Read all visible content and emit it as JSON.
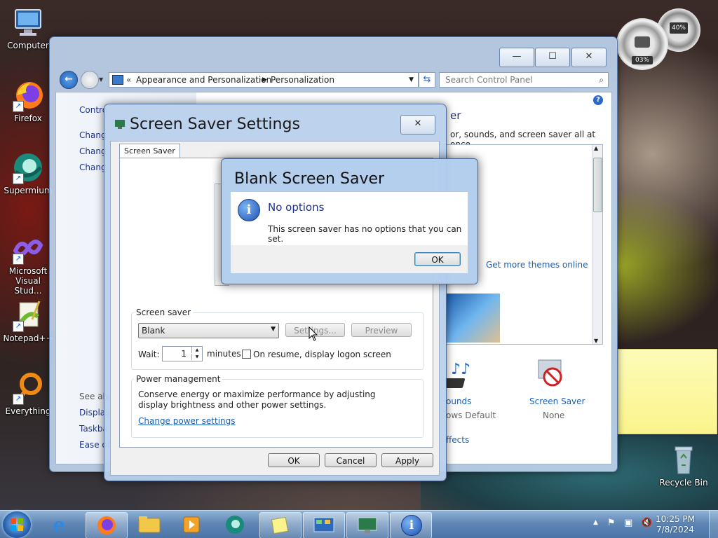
{
  "desktop": {
    "icons": [
      {
        "label": "Computer"
      },
      {
        "label": "Firefox"
      },
      {
        "label": "Supermium"
      },
      {
        "label": "Microsoft Visual Stud..."
      },
      {
        "label": "Notepad++"
      },
      {
        "label": "Everything"
      },
      {
        "label": "Recycle Bin"
      }
    ],
    "gadget": {
      "cpu": "03%",
      "memory": "40%"
    }
  },
  "control_panel": {
    "breadcrumb": [
      "Appearance and Personalization",
      "Personalization"
    ],
    "search_placeholder": "Search Control Panel",
    "left_links": {
      "home": "Contro",
      "link1": "Chang",
      "link2": "Chang",
      "link3": "Chang",
      "see_also": "See als",
      "display": "Display",
      "taskbar": "Taskba",
      "ease": "Ease of"
    },
    "heading_fragment": "er",
    "description_fragment": "or, sounds, and screen saver all at once.",
    "get_more_themes": "Get more themes online",
    "bottom_items": {
      "sounds_label": "ounds",
      "sounds_value": "ows Default",
      "screensaver_label": "Screen Saver",
      "screensaver_value": "None",
      "effects": "ffects"
    }
  },
  "screen_saver_dialog": {
    "title": "Screen Saver Settings",
    "tab": "Screen Saver",
    "screen_saver_group": "Screen saver",
    "selected_saver": "Blank",
    "settings_button": "Settings...",
    "preview_button": "Preview",
    "wait_label": "Wait:",
    "wait_value": "1",
    "minutes_label": "minutes",
    "resume_label": "On resume, display logon screen",
    "power_group": "Power management",
    "power_text": "Conserve energy or maximize performance by adjusting display brightness and other power settings.",
    "power_link": "Change power settings",
    "ok": "OK",
    "cancel": "Cancel",
    "apply": "Apply"
  },
  "message_box": {
    "title": "Blank Screen Saver",
    "heading": "No options",
    "body": "This screen saver has no options that you can set.",
    "ok": "OK"
  },
  "taskbar": {
    "time": "10:25 PM",
    "date": "7/8/2024"
  },
  "colors": {
    "accent": "#1a5fb4",
    "heading_blue": "#1e3287"
  }
}
